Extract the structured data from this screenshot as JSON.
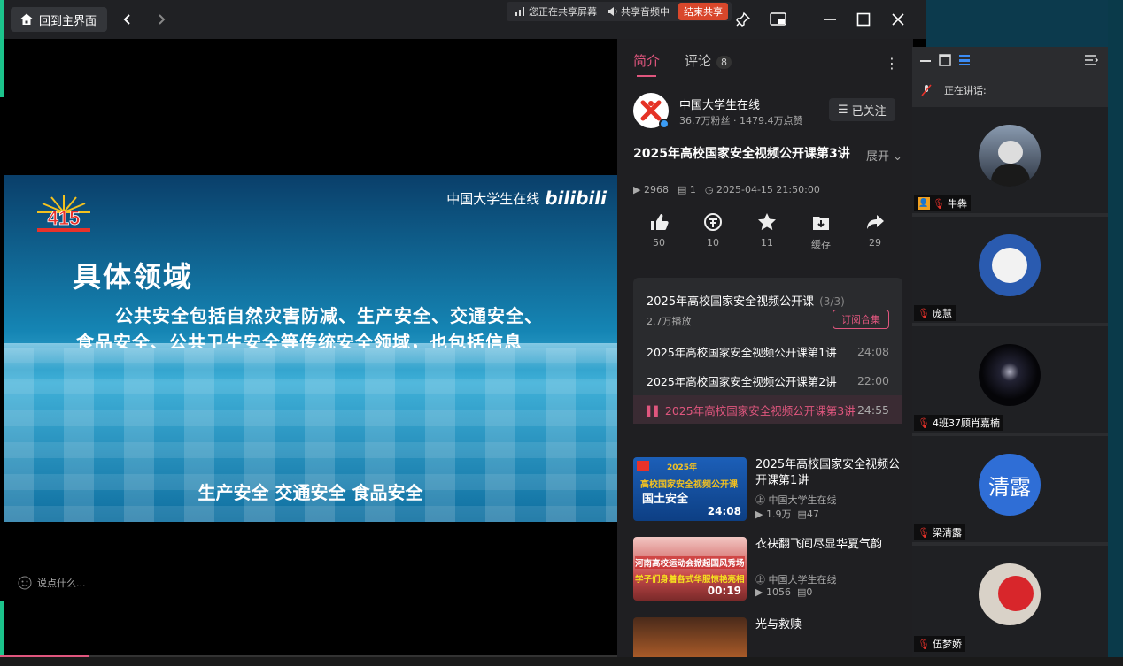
{
  "topbar": {
    "home_label": "回到主界面",
    "share_status": "您正在共享屏幕",
    "share_audio": "共享音频中",
    "stop_share": "结束共享"
  },
  "video": {
    "brand": "中国大学生在线",
    "brand_logo": "bilibili",
    "logo_text": "415",
    "title": "具体领域",
    "line1": "公共安全包括自然灾害防减、生产安全、交通安全、",
    "line2": "食品安全、公共卫生安全等传统安全领域，也包括信息",
    "subtitle": "生产安全 交通安全 食品安全",
    "comment_placeholder": "说点什么..."
  },
  "panel": {
    "tabs": [
      {
        "label": "简介"
      },
      {
        "label": "评论",
        "count": "8"
      }
    ],
    "uploader": {
      "name": "中国大学生在线",
      "stats": "36.7万粉丝 · 1479.4万点赞",
      "follow_label": "已关注"
    },
    "video_title": "2025年高校国家安全视频公开课第3讲",
    "expand_label": "展开",
    "meta": {
      "plays": "2968",
      "danmaku": "1",
      "date": "2025-04-15 21:50:00"
    },
    "actions": [
      {
        "icon": "thumbs-up-icon",
        "value": "50"
      },
      {
        "icon": "coin-icon",
        "value": "10"
      },
      {
        "icon": "star-icon",
        "value": "11"
      },
      {
        "icon": "download-icon",
        "value": "缓存"
      },
      {
        "icon": "share-icon",
        "value": "29"
      }
    ],
    "collection": {
      "title": "2025年高校国家安全视频公开课",
      "progress": "(3/3)",
      "plays": "2.7万播放",
      "subscribe_label": "订阅合集",
      "episodes": [
        {
          "title": "2025年高校国家安全视频公开课第1讲",
          "duration": "24:08"
        },
        {
          "title": "2025年高校国家安全视频公开课第2讲",
          "duration": "22:00"
        },
        {
          "title": "2025年高校国家安全视频公开课第3讲",
          "duration": "24:55"
        }
      ]
    },
    "recommendations": [
      {
        "title": "2025年高校国家安全视频公开课第1讲",
        "uploader": "中国大学生在线",
        "plays": "1.9万",
        "danmaku": "47",
        "duration": "24:08",
        "thumb_text": "国土安全",
        "thumb_year": "2025年",
        "thumb_banner": "高校国家安全视频公开课"
      },
      {
        "title": "衣袂翻飞间尽显华夏气韵",
        "uploader": "中国大学生在线",
        "plays": "1056",
        "danmaku": "0",
        "duration": "00:19",
        "thumb_text": "河南高校运动会掀起国风秀场",
        "thumb_banner": "学子们身着各式华服惊艳亮相"
      },
      {
        "title": "光与救赎",
        "uploader": "",
        "plays": "",
        "danmaku": "",
        "duration": "",
        "thumb_text": ""
      }
    ]
  },
  "meeting": {
    "speaking_label": "正在讲话:",
    "participants": [
      {
        "name": "牛犇",
        "host": true
      },
      {
        "name": "庞慧",
        "host": false
      },
      {
        "name": "4班37顾肖嘉楠",
        "host": false
      },
      {
        "name": "梁清露",
        "host": false,
        "avatar_text": "清露"
      },
      {
        "name": "伍梦娇",
        "host": false
      }
    ]
  },
  "colors": {
    "accent": "#e0567e",
    "stop_share": "#d9472b",
    "avatar_blue": "#2f6ed6"
  }
}
